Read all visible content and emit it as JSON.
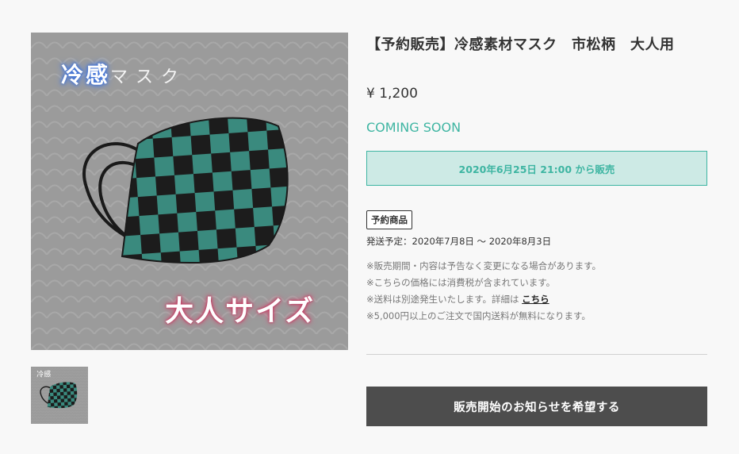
{
  "product": {
    "title": "【予約販売】冷感素材マスク　市松柄　大人用",
    "price": "¥ 1,200",
    "status": "COMING SOON",
    "sale_start": "2020年6月25日 21:00 から販売",
    "badge": "予約商品",
    "ship_date": "発送予定：2020年7月8日 〜 2020年8月3日"
  },
  "image": {
    "caption_cool": "冷感",
    "caption_mask": "マスク",
    "caption_size": "大人サイズ",
    "check_colors": [
      "#3a8a7e",
      "#1c1c1c"
    ]
  },
  "notes": {
    "line1": "※販売期間・内容は予告なく変更になる場合があります。",
    "line2": "※こちらの価格には消費税が含まれています。",
    "line3_prefix": "※送料は別途発生いたします。詳細は",
    "line3_link": "こちら",
    "line4": "※5,000円以上のご注文で国内送料が無料になります。"
  },
  "actions": {
    "notify": "販売開始のお知らせを希望する"
  },
  "colors": {
    "accent": "#3eb5a2",
    "accent_bg": "#cdeae5",
    "button_bg": "#4d4d4d"
  }
}
